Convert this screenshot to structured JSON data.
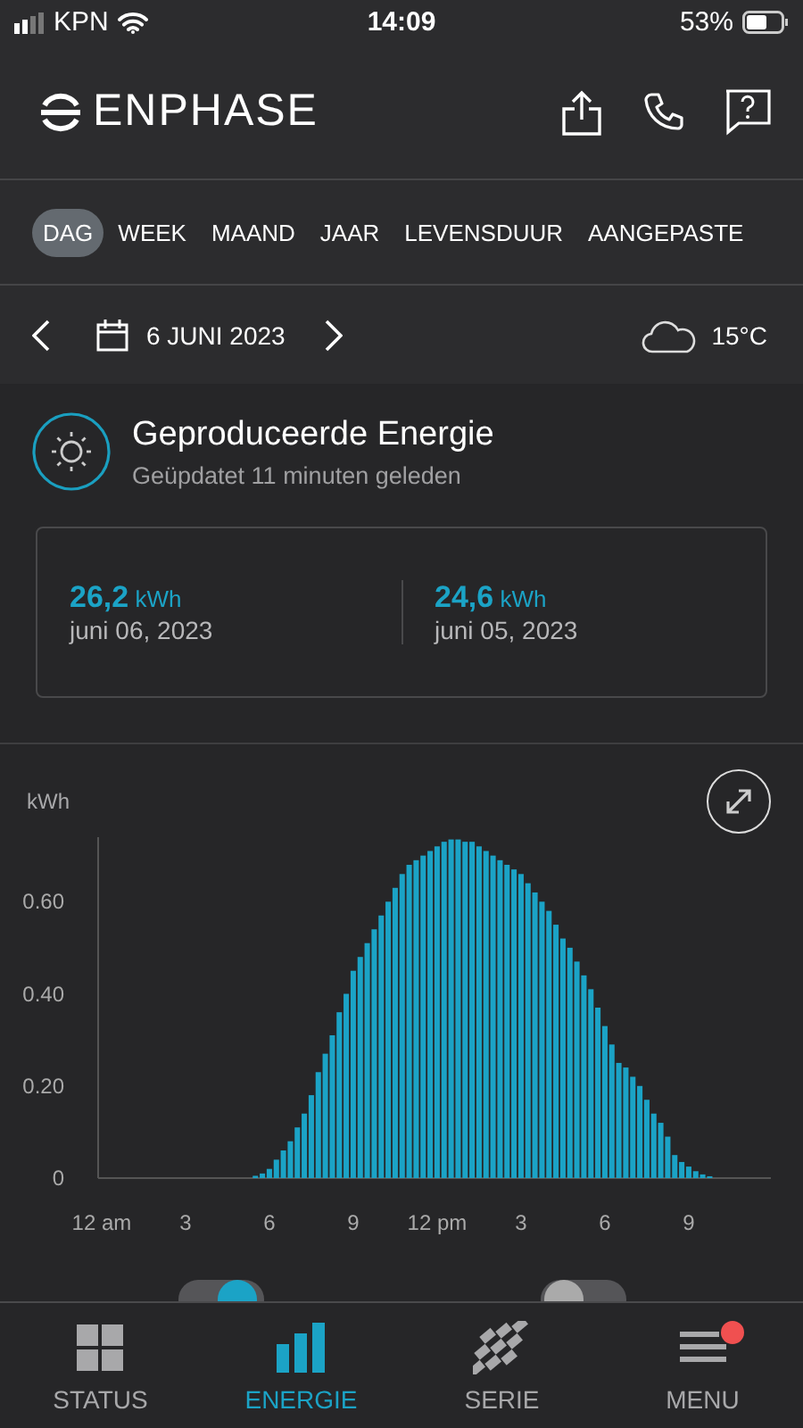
{
  "status_bar": {
    "carrier": "KPN",
    "time": "14:09",
    "battery": "53%"
  },
  "header": {
    "logo": "ENPHASE"
  },
  "period_tabs": [
    {
      "label": "DAG",
      "selected": true
    },
    {
      "label": "WEEK",
      "selected": false
    },
    {
      "label": "MAAND",
      "selected": false
    },
    {
      "label": "JAAR",
      "selected": false
    },
    {
      "label": "LEVENSDUUR",
      "selected": false
    },
    {
      "label": "AANGEPASTE",
      "selected": false
    }
  ],
  "date_bar": {
    "date": "6 JUNI 2023",
    "temperature": "15°C"
  },
  "energy_card": {
    "title": "Geproduceerde Energie",
    "subtitle": "Geüpdatet 11 minuten geleden",
    "totals": [
      {
        "value": "26,2",
        "unit": "kWh",
        "date": "juni 06, 2023"
      },
      {
        "value": "24,6",
        "unit": "kWh",
        "date": "juni 05, 2023"
      }
    ]
  },
  "chart": {
    "chart_data": {
      "type": "bar",
      "ylabel": "kWh",
      "ylim": [
        0,
        0.74
      ],
      "yticks": [
        {
          "value": 0,
          "label": "0"
        },
        {
          "value": 0.2,
          "label": "0.20"
        },
        {
          "value": 0.4,
          "label": "0.40"
        },
        {
          "value": 0.6,
          "label": "0.60"
        }
      ],
      "categories": [
        "12 am",
        null,
        null,
        null,
        null,
        null,
        null,
        null,
        null,
        null,
        null,
        null,
        "3",
        null,
        null,
        null,
        null,
        null,
        null,
        null,
        null,
        null,
        null,
        null,
        "6",
        null,
        null,
        null,
        null,
        null,
        null,
        null,
        null,
        null,
        null,
        null,
        "9",
        null,
        null,
        null,
        null,
        null,
        null,
        null,
        null,
        null,
        null,
        null,
        "12 pm",
        null,
        null,
        null,
        null,
        null,
        null,
        null,
        null,
        null,
        null,
        null,
        "3",
        null,
        null,
        null,
        null,
        null,
        null,
        null,
        null,
        null,
        null,
        null,
        "6",
        null,
        null,
        null,
        null,
        null,
        null,
        null,
        null,
        null,
        null,
        null,
        "9",
        null,
        null,
        null,
        null,
        null,
        null,
        null,
        null,
        null,
        null,
        null
      ],
      "series": [
        {
          "color": "#1ba3c6",
          "values": [
            null,
            null,
            null,
            null,
            null,
            null,
            null,
            null,
            null,
            null,
            null,
            null,
            null,
            null,
            null,
            null,
            null,
            null,
            null,
            null,
            null,
            null,
            0.005,
            0.01,
            0.02,
            0.04,
            0.06,
            0.08,
            0.11,
            0.14,
            0.18,
            0.23,
            0.27,
            0.31,
            0.36,
            0.4,
            0.45,
            0.48,
            0.51,
            0.54,
            0.57,
            0.6,
            0.63,
            0.66,
            0.68,
            0.69,
            0.7,
            0.71,
            0.72,
            0.73,
            0.735,
            0.735,
            0.73,
            0.73,
            0.72,
            0.71,
            0.7,
            0.69,
            0.68,
            0.67,
            0.66,
            0.64,
            0.62,
            0.6,
            0.58,
            0.55,
            0.52,
            0.5,
            0.47,
            0.44,
            0.41,
            0.37,
            0.33,
            0.29,
            0.25,
            0.24,
            0.22,
            0.2,
            0.17,
            0.14,
            0.12,
            0.09,
            0.05,
            0.035,
            0.025,
            0.015,
            0.008,
            0.004,
            null,
            null,
            null,
            null,
            null,
            null,
            null,
            null
          ]
        }
      ]
    },
    "toggles": [
      {
        "on": true
      },
      {
        "on": false
      }
    ]
  },
  "bottom_tabs": [
    {
      "label": "STATUS",
      "kind": "grid",
      "selected": false,
      "badge": false
    },
    {
      "label": "ENERGIE",
      "kind": "bars",
      "selected": true,
      "badge": false
    },
    {
      "label": "SERIE",
      "kind": "panels",
      "selected": false,
      "badge": false
    },
    {
      "label": "MENU",
      "kind": "menu",
      "selected": false,
      "badge": true
    }
  ]
}
